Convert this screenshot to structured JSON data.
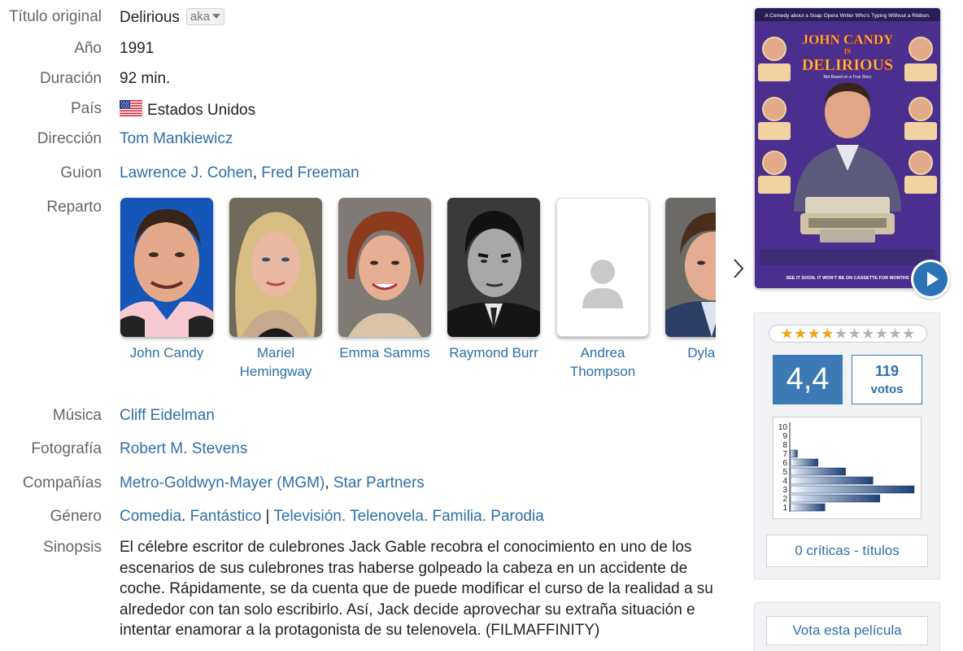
{
  "fields": {
    "titulo": {
      "label": "Título original",
      "value": "Delirious",
      "aka": "aka"
    },
    "anio": {
      "label": "Año",
      "value": "1991"
    },
    "duracion": {
      "label": "Duración",
      "value": "92 min."
    },
    "pais": {
      "label": "País",
      "value": "Estados Unidos"
    },
    "direccion": {
      "label": "Dirección",
      "value": "Tom Mankiewicz"
    },
    "guion": {
      "label": "Guion",
      "people": [
        "Lawrence J. Cohen",
        "Fred Freeman"
      ],
      "sep": ","
    },
    "reparto": {
      "label": "Reparto"
    },
    "musica": {
      "label": "Música",
      "value": "Cliff Eidelman"
    },
    "fotografia": {
      "label": "Fotografía",
      "value": "Robert M. Stevens"
    },
    "companias": {
      "label": "Compañías",
      "items": [
        "Metro-Goldwyn-Mayer (MGM)",
        "Star Partners"
      ],
      "sep": ","
    },
    "genero": {
      "label": "Género",
      "items": [
        "Comedia",
        "Fantástico",
        "Televisión",
        "Telenovela",
        "Familia",
        "Parodia"
      ],
      "dot": ".",
      "bar": "|"
    },
    "sinopsis": {
      "label": "Sinopsis",
      "text": "El célebre escritor de culebrones Jack Gable recobra el conocimiento en uno de los escenarios de sus culebrones tras haberse golpeado la cabeza en un accidente de coche. Rápidamente, se da cuenta que de puede modificar el curso de la realidad a su alrededor con tan solo escribirlo. Así, Jack decide aprovechar su extraña situación e intentar enamorar a la protagonista de su telenovela. (FILMAFFINITY)"
    }
  },
  "cast": [
    {
      "line1": "John Candy",
      "line2": ""
    },
    {
      "line1": "Mariel",
      "line2": "Hemingway"
    },
    {
      "line1": "Emma Samms",
      "line2": ""
    },
    {
      "line1": "Raymond Burr",
      "line2": ""
    },
    {
      "line1": "Andrea",
      "line2": "Thompson"
    },
    {
      "line1": "Dylan B",
      "line2": ""
    }
  ],
  "poster": {
    "tagline": "A Comedy about a Soap Opera Writer Who's Typing Without a Ribbon.",
    "title_line1": "JOHN CANDY",
    "title_is": "IS",
    "title_line2": "DELIRIOUS",
    "subtitle": "Not Based on a True Story",
    "footer": "SEE IT SOON. IT WON'T BE ON CASSETTE FOR MONTHS"
  },
  "rating": {
    "stars": "★★★★★★★★★★",
    "stars_filled": 4.4,
    "score": "4,4",
    "votes_count": "119",
    "votes_label": "votos",
    "histogram_labels": [
      "10",
      "9",
      "8",
      "7",
      "6",
      "5",
      "4",
      "3",
      "2",
      "1"
    ],
    "histogram_values": [
      0,
      0,
      0,
      1,
      4,
      8,
      12,
      18,
      13,
      5
    ],
    "reviews_link": "0 críticas - títulos"
  },
  "vote_button": "Vota esta película",
  "colors": {
    "link": "#2e6fa8",
    "score_bg": "#3d79b5",
    "play": "#2a73b7",
    "star": "#f1a21a"
  }
}
